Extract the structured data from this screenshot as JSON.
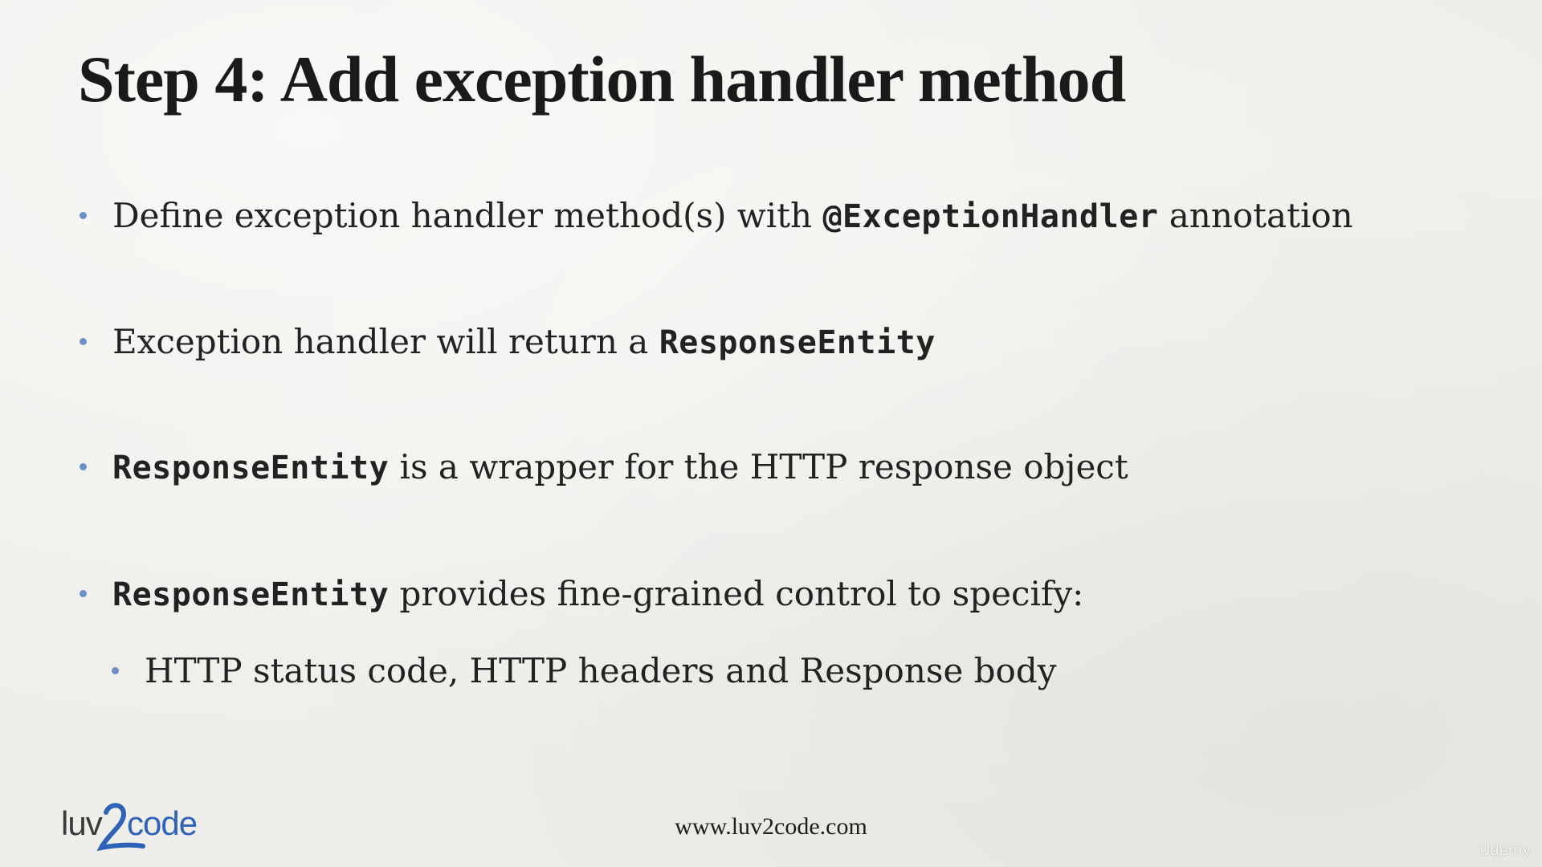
{
  "slide": {
    "title": "Step 4:  Add exception handler method",
    "bullets": [
      {
        "before": "Define exception handler method(s) with ",
        "code": "@ExceptionHandler",
        "after": " annotation"
      },
      {
        "before": "Exception handler will return a ",
        "code": "ResponseEntity",
        "after": ""
      },
      {
        "before": "",
        "code": "ResponseEntity",
        "after": " is a wrapper for the HTTP response object"
      },
      {
        "before": "",
        "code": "ResponseEntity",
        "after": " provides fine-grained control to specify:"
      }
    ],
    "sub_bullet": "HTTP status code, HTTP headers and Response body"
  },
  "footer": {
    "url": "www.luv2code.com",
    "logo_text": "luv2code",
    "watermark": "Udemy"
  },
  "colors": {
    "background": "#efeeea",
    "bullet_dot": "#6b8fc9",
    "logo_text": "#3a3a3a",
    "logo_accent": "#2f63b8"
  },
  "icons": {
    "logo": "luv2code-logo"
  }
}
